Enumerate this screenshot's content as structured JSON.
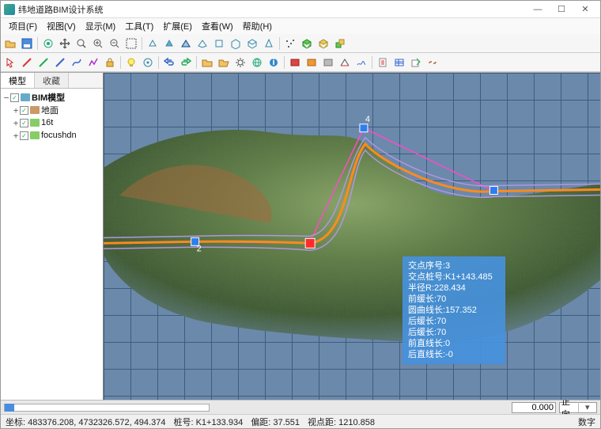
{
  "title": "纬地道路BIM设计系统",
  "menu": {
    "file": "项目(F)",
    "view": "视图(V)",
    "display": "显示(M)",
    "tools": "工具(T)",
    "extend": "扩展(E)",
    "browse": "查看(W)",
    "help": "帮助(H)"
  },
  "winctl": {
    "min": "—",
    "max": "☐",
    "close": "✕"
  },
  "sidebar": {
    "tabs": {
      "model": "模型",
      "favorites": "收藏"
    },
    "root": "BIM模型",
    "nodes": {
      "n0": "地面",
      "n1": "16t",
      "n2": "focushdn"
    }
  },
  "tooltip": {
    "l0": "交点序号:3",
    "l1": "交点桩号:K1+143.485",
    "l2": "半径R:228.434",
    "l3": "前缓长:70",
    "l4": "圆曲线长:157.352",
    "l5": "后缓长:70",
    "l6": "后缓长:70",
    "l7": "前直线长:0",
    "l8": "后直线长:-0"
  },
  "bottom": {
    "value": "0.000",
    "combo": "正向"
  },
  "status": {
    "coord": "坐标: 483376.208, 4732326.572, 494.374",
    "chain": "桩号: K1+133.934",
    "offset": "偏距: 37.551",
    "viewdist": "视点距: 1210.858",
    "mode": "数字"
  },
  "colors": {
    "accent": "#4a8de0"
  }
}
